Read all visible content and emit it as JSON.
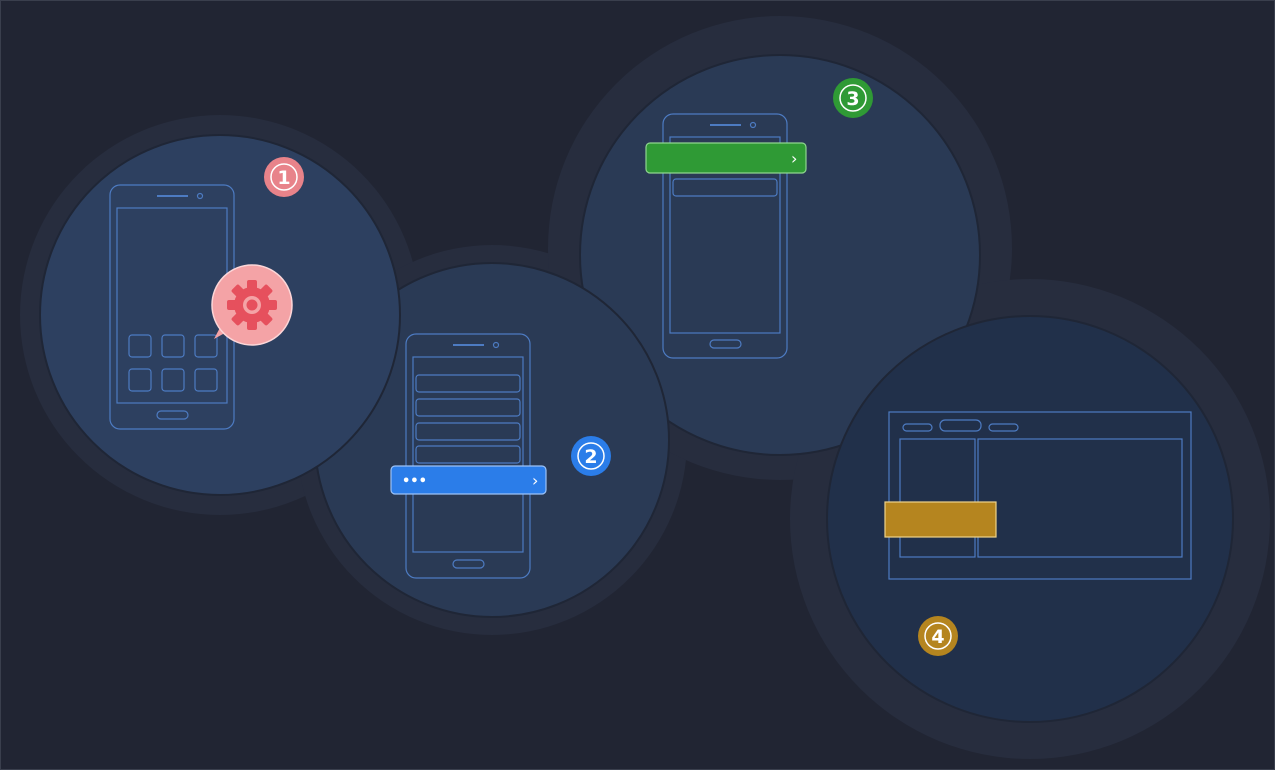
{
  "steps": [
    {
      "number": "1",
      "color": "#e8838a"
    },
    {
      "number": "2",
      "color": "#2b7de9"
    },
    {
      "number": "3",
      "color": "#2f9a35"
    },
    {
      "number": "4",
      "color": "#b5851f"
    }
  ],
  "icons": {
    "settings": "gear-icon",
    "menu": "more-dots-icon",
    "chevron": "chevron-right-icon"
  },
  "colors": {
    "background": "#212533",
    "circle": "#2a3a55",
    "circle_halo": "#272d3e",
    "outline": "#4d7bc2",
    "blue_bar": "#2b7de9",
    "green_bar": "#2f9a35",
    "gold_bar": "#b5851f",
    "settings_bubble": "#f4a3a6",
    "gear": "#e6505d"
  },
  "bars": {
    "menu_text": "•••",
    "chevron": "›"
  }
}
